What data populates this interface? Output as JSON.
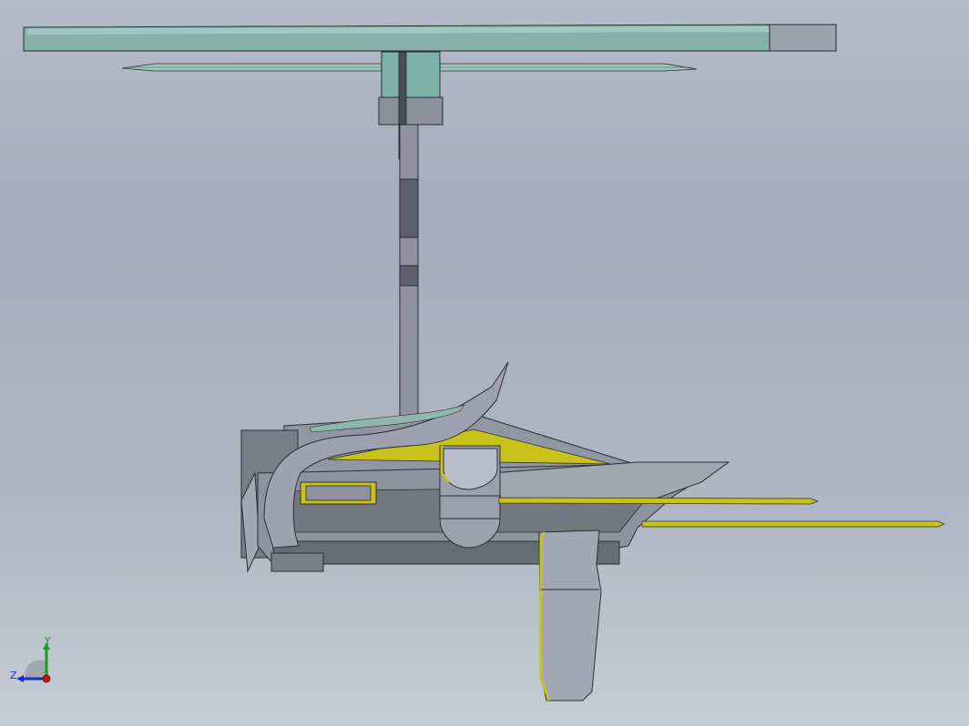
{
  "viewport": {
    "background_top": "#b4bcc8",
    "background_bottom": "#c7ccd4"
  },
  "model": {
    "colors": {
      "body_gray": "#8e939f",
      "body_light": "#b4b8c6",
      "body_dark": "#5c606a",
      "edge": "#2a2d33",
      "yellow": "#c9c21a",
      "glass_top": "#8fb5ad",
      "glass_bottom": "#6e968f"
    }
  },
  "triad": {
    "y_label": "Y",
    "z_label": "Z",
    "colors": {
      "y_axis": "#1a9a1a",
      "z_axis": "#1a2ad0",
      "origin": "#d01010"
    }
  }
}
